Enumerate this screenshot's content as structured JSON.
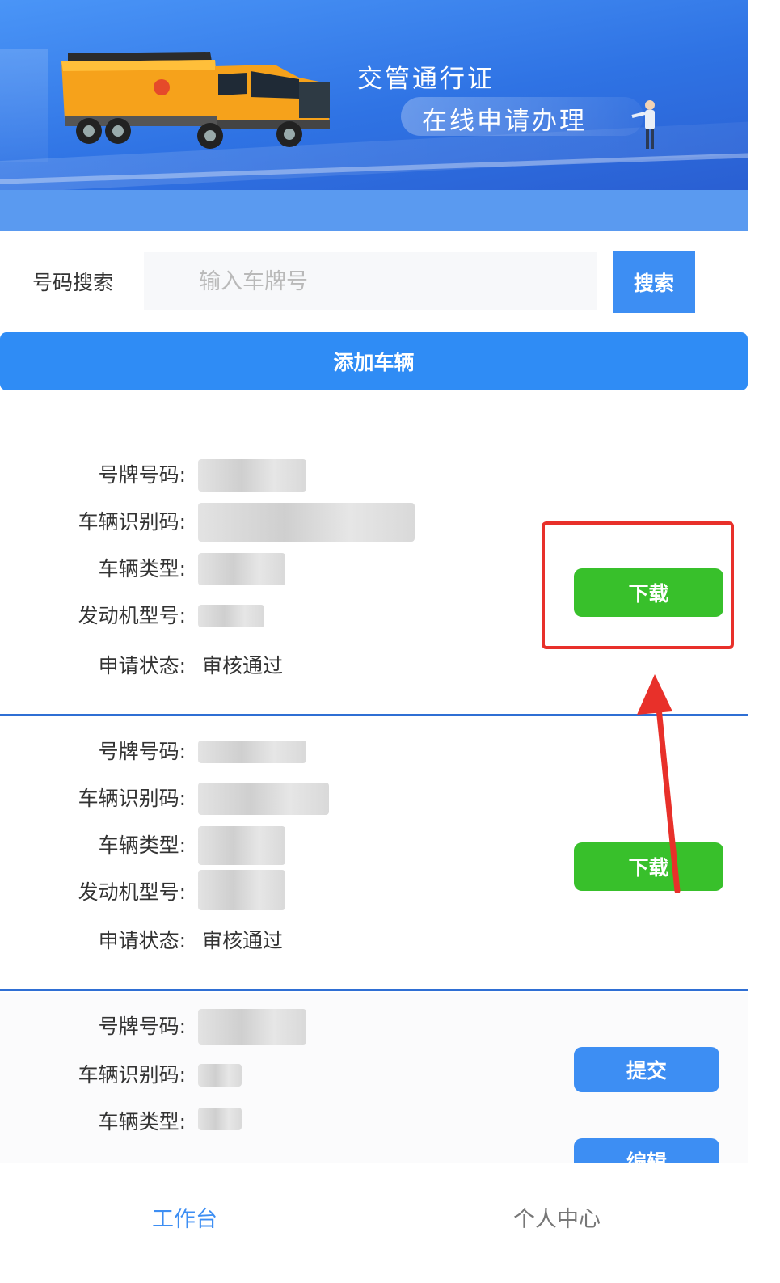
{
  "banner": {
    "title": "交管通行证",
    "subtitle": "在线申请办理"
  },
  "search": {
    "label": "号码搜索",
    "placeholder": "输入车牌号",
    "button_label": "搜索"
  },
  "add_vehicle_label": "添加车辆",
  "vehicles": [
    {
      "labels": [
        "号牌号码:",
        "车辆识别码:",
        "车辆类型:",
        "发动机型号:",
        "申请状态:"
      ],
      "status": "审核通过",
      "actions": [
        "下载"
      ]
    },
    {
      "labels": [
        "号牌号码:",
        "车辆识别码:",
        "车辆类型:",
        "发动机型号:",
        "申请状态:"
      ],
      "status": "审核通过",
      "actions": [
        "下载"
      ]
    },
    {
      "labels": [
        "号牌号码:",
        "车辆识别码:",
        "车辆类型:"
      ],
      "actions": [
        "提交",
        "编辑"
      ]
    }
  ],
  "tabs": [
    {
      "label": "工作台",
      "active": true
    },
    {
      "label": "个人中心",
      "active": false
    }
  ],
  "colors": {
    "primary": "#3d8ef3",
    "success": "#38c02b",
    "annotation": "#e8302a",
    "divider": "#2f6fd4"
  }
}
